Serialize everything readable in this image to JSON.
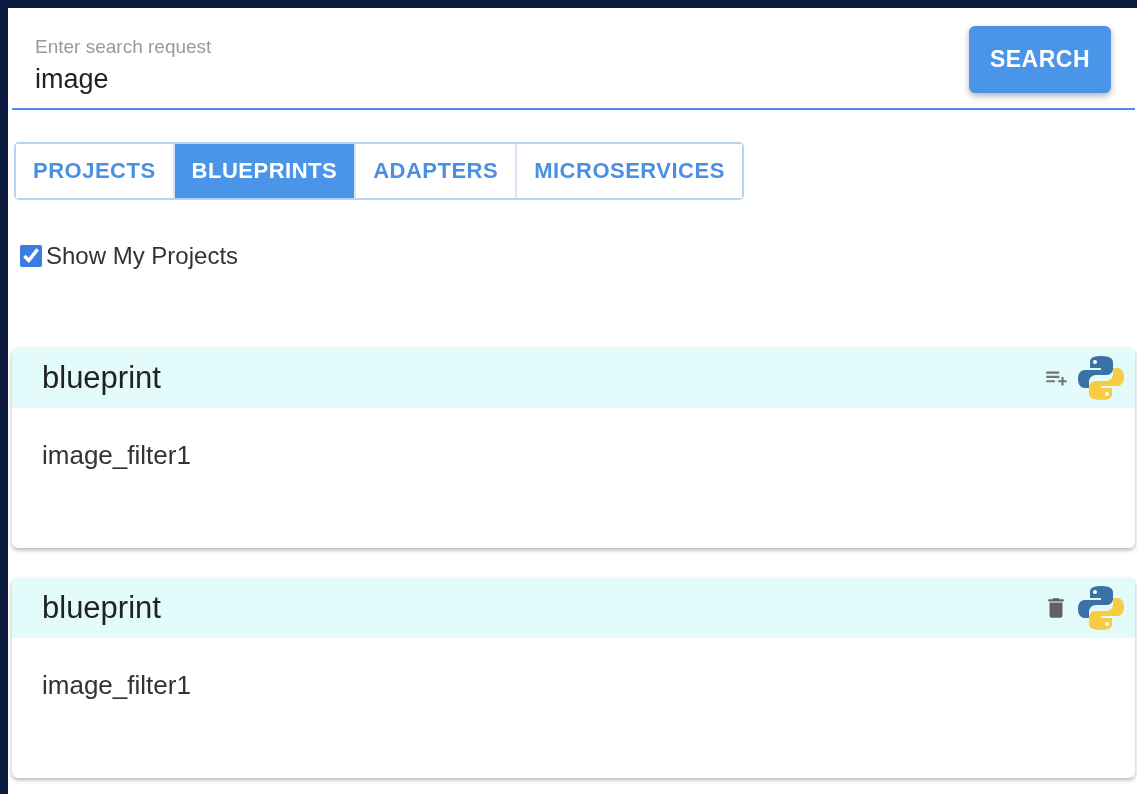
{
  "search": {
    "placeholder": "Enter search request",
    "value": "image",
    "button": "SEARCH"
  },
  "tabs": [
    {
      "label": "PROJECTS",
      "selected": false
    },
    {
      "label": "BLUEPRINTS",
      "selected": true
    },
    {
      "label": "ADAPTERS",
      "selected": false
    },
    {
      "label": "MICROSERVICES",
      "selected": false
    }
  ],
  "show_my_projects": {
    "label": "Show My Projects",
    "checked": true
  },
  "cards": [
    {
      "title": "blueprint",
      "name": "image_filter1",
      "kind": "add"
    },
    {
      "title": "blueprint",
      "name": "image_filter1",
      "kind": "delete"
    }
  ]
}
